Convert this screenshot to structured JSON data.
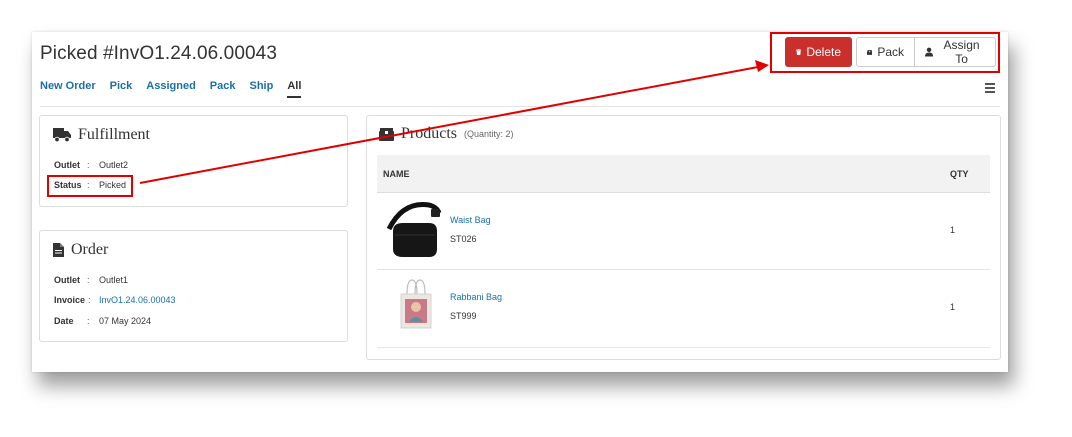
{
  "header": {
    "title": "Picked #InvO1.24.06.00043"
  },
  "actions": {
    "delete_label": "Delete",
    "pack_label": "Pack",
    "assign_label": "Assign To"
  },
  "tabs": [
    {
      "label": "New Order"
    },
    {
      "label": "Pick"
    },
    {
      "label": "Assigned"
    },
    {
      "label": "Pack"
    },
    {
      "label": "Ship"
    },
    {
      "label": "All",
      "active": true
    }
  ],
  "fulfillment": {
    "title": "Fulfillment",
    "outlet_label": "Outlet",
    "outlet_value": "Outlet2",
    "status_label": "Status",
    "status_value": "Picked"
  },
  "order": {
    "title": "Order",
    "outlet_label": "Outlet",
    "outlet_value": "Outlet1",
    "invoice_label": "Invoice",
    "invoice_value": "InvO1.24.06.00043",
    "date_label": "Date",
    "date_value": "07 May 2024"
  },
  "products": {
    "title": "Products",
    "quantity_note": "(Quantity: 2)",
    "col_name": "NAME",
    "col_qty": "QTY",
    "items": [
      {
        "name": "Waist Bag",
        "sku": "ST026",
        "qty": "1"
      },
      {
        "name": "Rabbani Bag",
        "sku": "ST999",
        "qty": "1"
      }
    ]
  },
  "sep": ":",
  "colors": {
    "danger": "#c9302c",
    "link": "#1a6fa8",
    "highlight": "#e00000"
  }
}
